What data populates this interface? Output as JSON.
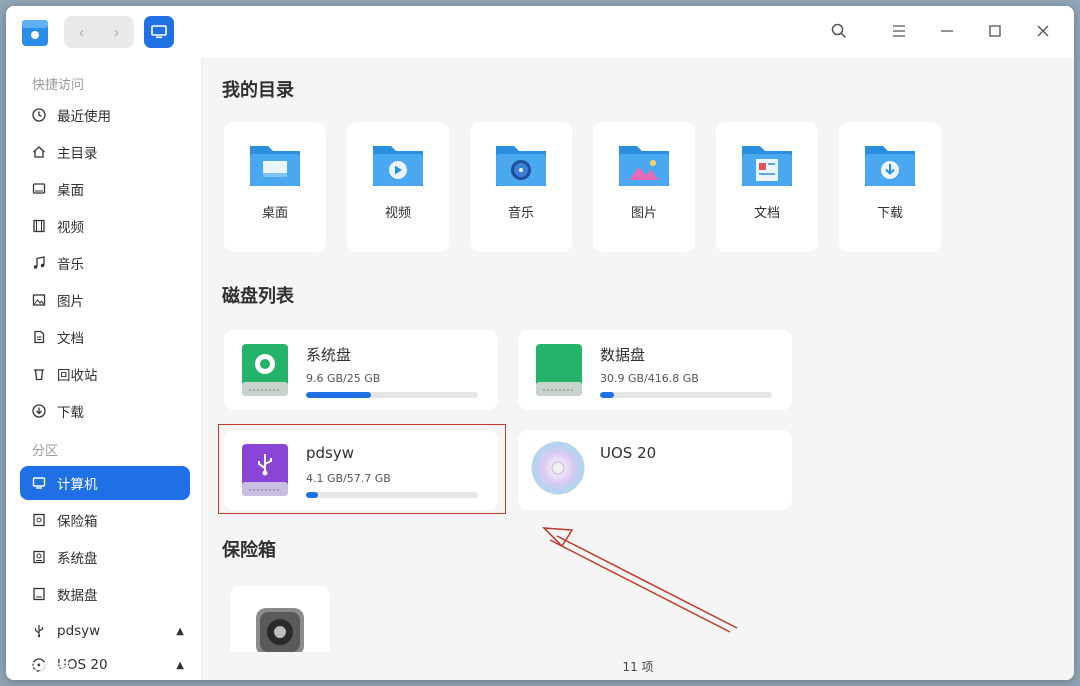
{
  "titlebar": {
    "nav_back": "‹",
    "nav_forward": "›"
  },
  "sidebar": {
    "quick_access_label": "快捷访问",
    "quick_items": [
      {
        "label": "最近使用",
        "icon": "clock-icon"
      },
      {
        "label": "主目录",
        "icon": "home-icon"
      },
      {
        "label": "桌面",
        "icon": "desktop-icon"
      },
      {
        "label": "视频",
        "icon": "video-icon"
      },
      {
        "label": "音乐",
        "icon": "music-icon"
      },
      {
        "label": "图片",
        "icon": "picture-icon"
      },
      {
        "label": "文档",
        "icon": "document-icon"
      },
      {
        "label": "回收站",
        "icon": "trash-icon"
      },
      {
        "label": "下载",
        "icon": "download-icon"
      }
    ],
    "partition_label": "分区",
    "partition_items": [
      {
        "label": "计算机",
        "icon": "computer-icon",
        "active": true
      },
      {
        "label": "保险箱",
        "icon": "vault-icon"
      },
      {
        "label": "系统盘",
        "icon": "disk-icon"
      },
      {
        "label": "数据盘",
        "icon": "disk-icon"
      },
      {
        "label": "pdsyw",
        "icon": "usb-icon",
        "eject": true
      },
      {
        "label": "UOS 20",
        "icon": "disc-icon",
        "eject": true
      }
    ]
  },
  "main": {
    "my_dirs_title": "我的目录",
    "folders": [
      {
        "label": "桌面",
        "icon": "desktop-folder-icon"
      },
      {
        "label": "视频",
        "icon": "video-folder-icon"
      },
      {
        "label": "音乐",
        "icon": "music-folder-icon"
      },
      {
        "label": "图片",
        "icon": "picture-folder-icon"
      },
      {
        "label": "文档",
        "icon": "document-folder-icon"
      },
      {
        "label": "下载",
        "icon": "download-folder-icon"
      }
    ],
    "disks_title": "磁盘列表",
    "disks": [
      {
        "name": "系统盘",
        "size": "9.6 GB/25 GB",
        "usage": 0.38
      },
      {
        "name": "数据盘",
        "size": "30.9 GB/416.8 GB",
        "usage": 0.08
      },
      {
        "name": "pdsyw",
        "size": "4.1 GB/57.7 GB",
        "usage": 0.07
      },
      {
        "name": "UOS 20",
        "size": "",
        "usage": null
      }
    ],
    "vault_title": "保险箱"
  },
  "status": {
    "count": "11 项"
  },
  "watermark": "人民看镜",
  "colors": {
    "accent": "#1f6fe5",
    "highlight": "#c0392b"
  }
}
